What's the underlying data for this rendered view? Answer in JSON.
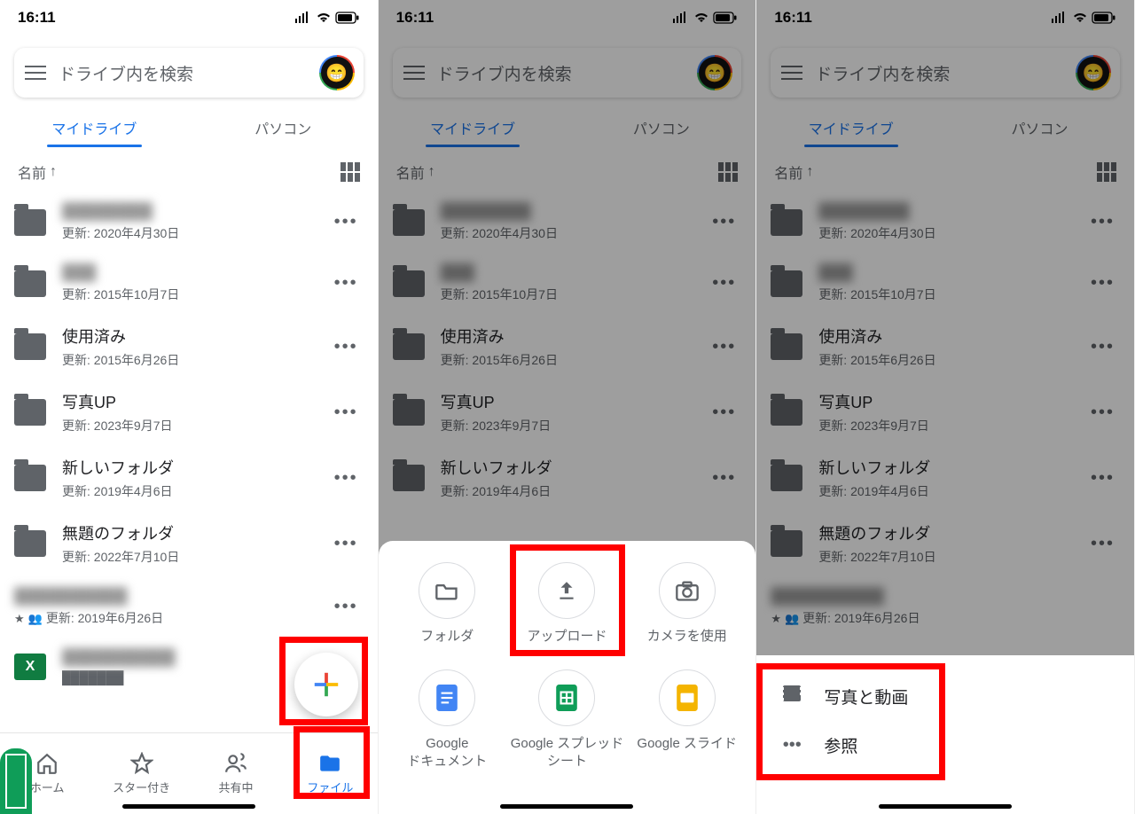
{
  "status": {
    "time": "16:11"
  },
  "search": {
    "placeholder": "ドライブ内を検索"
  },
  "tabs": {
    "mydrive": "マイドライブ",
    "computer": "パソコン"
  },
  "sort": {
    "label": "名前",
    "arrow": "↑"
  },
  "files": [
    {
      "name": "████████",
      "meta": "更新: 2020年4月30日",
      "type": "folder",
      "blurred": true
    },
    {
      "name": "███",
      "meta": "更新: 2015年10月7日",
      "type": "folder",
      "blurred": true
    },
    {
      "name": "使用済み",
      "meta": "更新: 2015年6月26日",
      "type": "folder"
    },
    {
      "name": "写真UP",
      "meta": "更新: 2023年9月7日",
      "type": "folder"
    },
    {
      "name": "新しいフォルダ",
      "meta": "更新: 2019年4月6日",
      "type": "folder"
    },
    {
      "name": "無題のフォルダ",
      "meta": "更新: 2022年7月10日",
      "type": "folder"
    },
    {
      "name": "██████████",
      "meta": "更新: 2019年6月26日",
      "type": "sheet",
      "blurred": true,
      "starred": true
    },
    {
      "name": "██████████",
      "meta": "",
      "type": "excel",
      "blurred": true
    }
  ],
  "bottomnav": {
    "home": "ホーム",
    "star": "スター付き",
    "shared": "共有中",
    "files": "ファイル"
  },
  "create_sheet": {
    "folder": "フォルダ",
    "upload": "アップロード",
    "camera": "カメラを使用",
    "docs": "Google\nドキュメント",
    "sheets": "Google スプレッドシート",
    "slides": "Google スライド"
  },
  "upload_menu": {
    "photos": "写真と動画",
    "browse": "参照"
  }
}
